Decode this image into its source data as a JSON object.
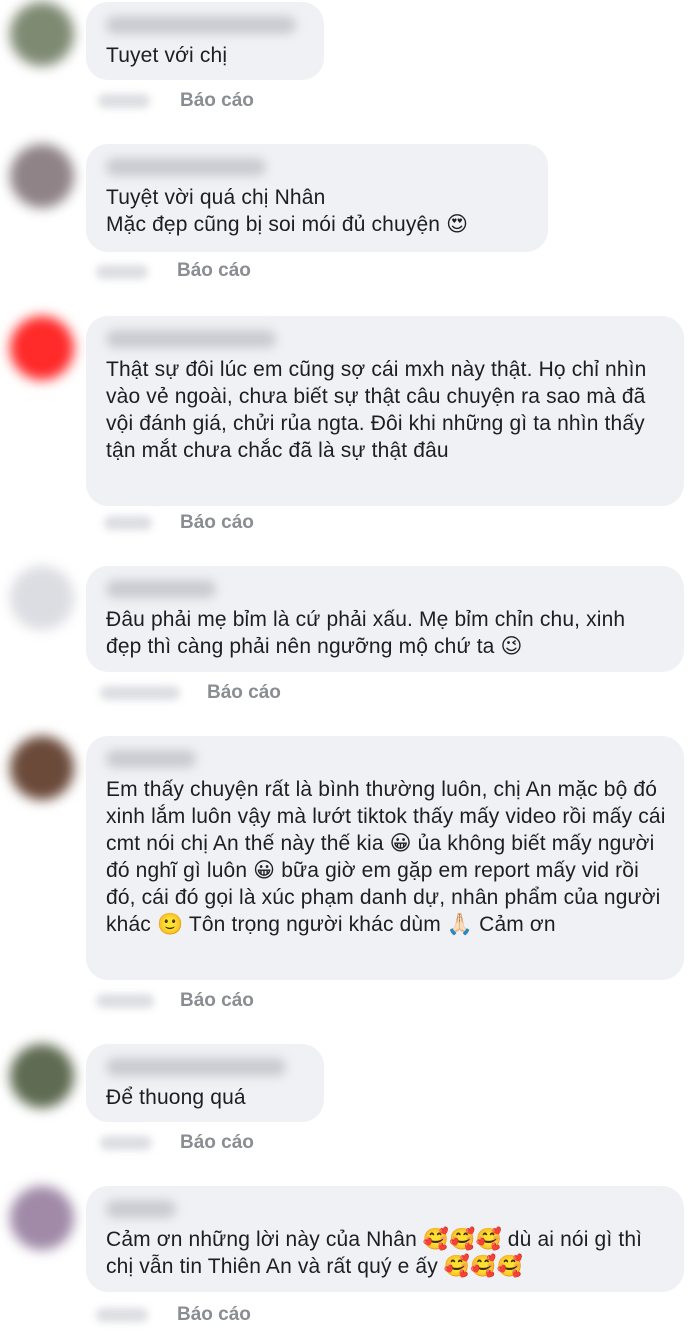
{
  "comments": [
    {
      "text": "Tuyet với chị",
      "report_label": "Báo cáo",
      "avatar_color": "#7f8a73"
    },
    {
      "text": "Tuyệt vời quá chị Nhân\nMặc đẹp cũng bị soi mói đủ chuyện 😍",
      "report_label": "Báo cáo",
      "avatar_color": "#8f8388"
    },
    {
      "text": "Thật sự đôi lúc em cũng sợ cái mxh này thật. Họ chỉ nhìn vào vẻ ngoài, chưa biết sự thật câu chuyện ra sao mà đã vội đánh giá, chửi rủa ngta. Đôi khi những gì ta nhìn thấy tận mắt chưa chắc đã là sự thật đâu",
      "report_label": "Báo cáo",
      "avatar_color": "#ff2a2a"
    },
    {
      "text": "Đâu phải mẹ bỉm là cứ phải xấu. Mẹ bỉm chỉn chu, xinh đẹp thì càng phải nên ngưỡng mộ chứ ta 😉",
      "report_label": "Báo cáo",
      "avatar_color": "#dcdde2"
    },
    {
      "text": "Em thấy chuyện rất là bình thường luôn, chị An mặc bộ đó xinh lắm luôn vậy mà lướt tiktok thấy mấy video rồi mấy cái cmt nói chị An thế này thế kia 😀 ủa không biết mấy người đó nghĩ gì luôn 😀 bữa giờ em gặp em report mấy vid rồi đó, cái đó gọi là xúc phạm danh dự, nhân phẩm của người khác 🙂 Tôn trọng người khác dùm 🙏🏻 Cảm ơn",
      "report_label": "Báo cáo",
      "avatar_color": "#6b4a3a"
    },
    {
      "text": "Để thuong quá",
      "report_label": "Báo cáo",
      "avatar_color": "#5f6b52"
    },
    {
      "text": "Cảm ơn những lời này của Nhân 🥰🥰🥰 dù ai nói gì thì chị vẫn tin Thiên An và rất quý e ấy 🥰🥰🥰",
      "report_label": "Báo cáo",
      "avatar_color": "#a08aa8"
    }
  ]
}
